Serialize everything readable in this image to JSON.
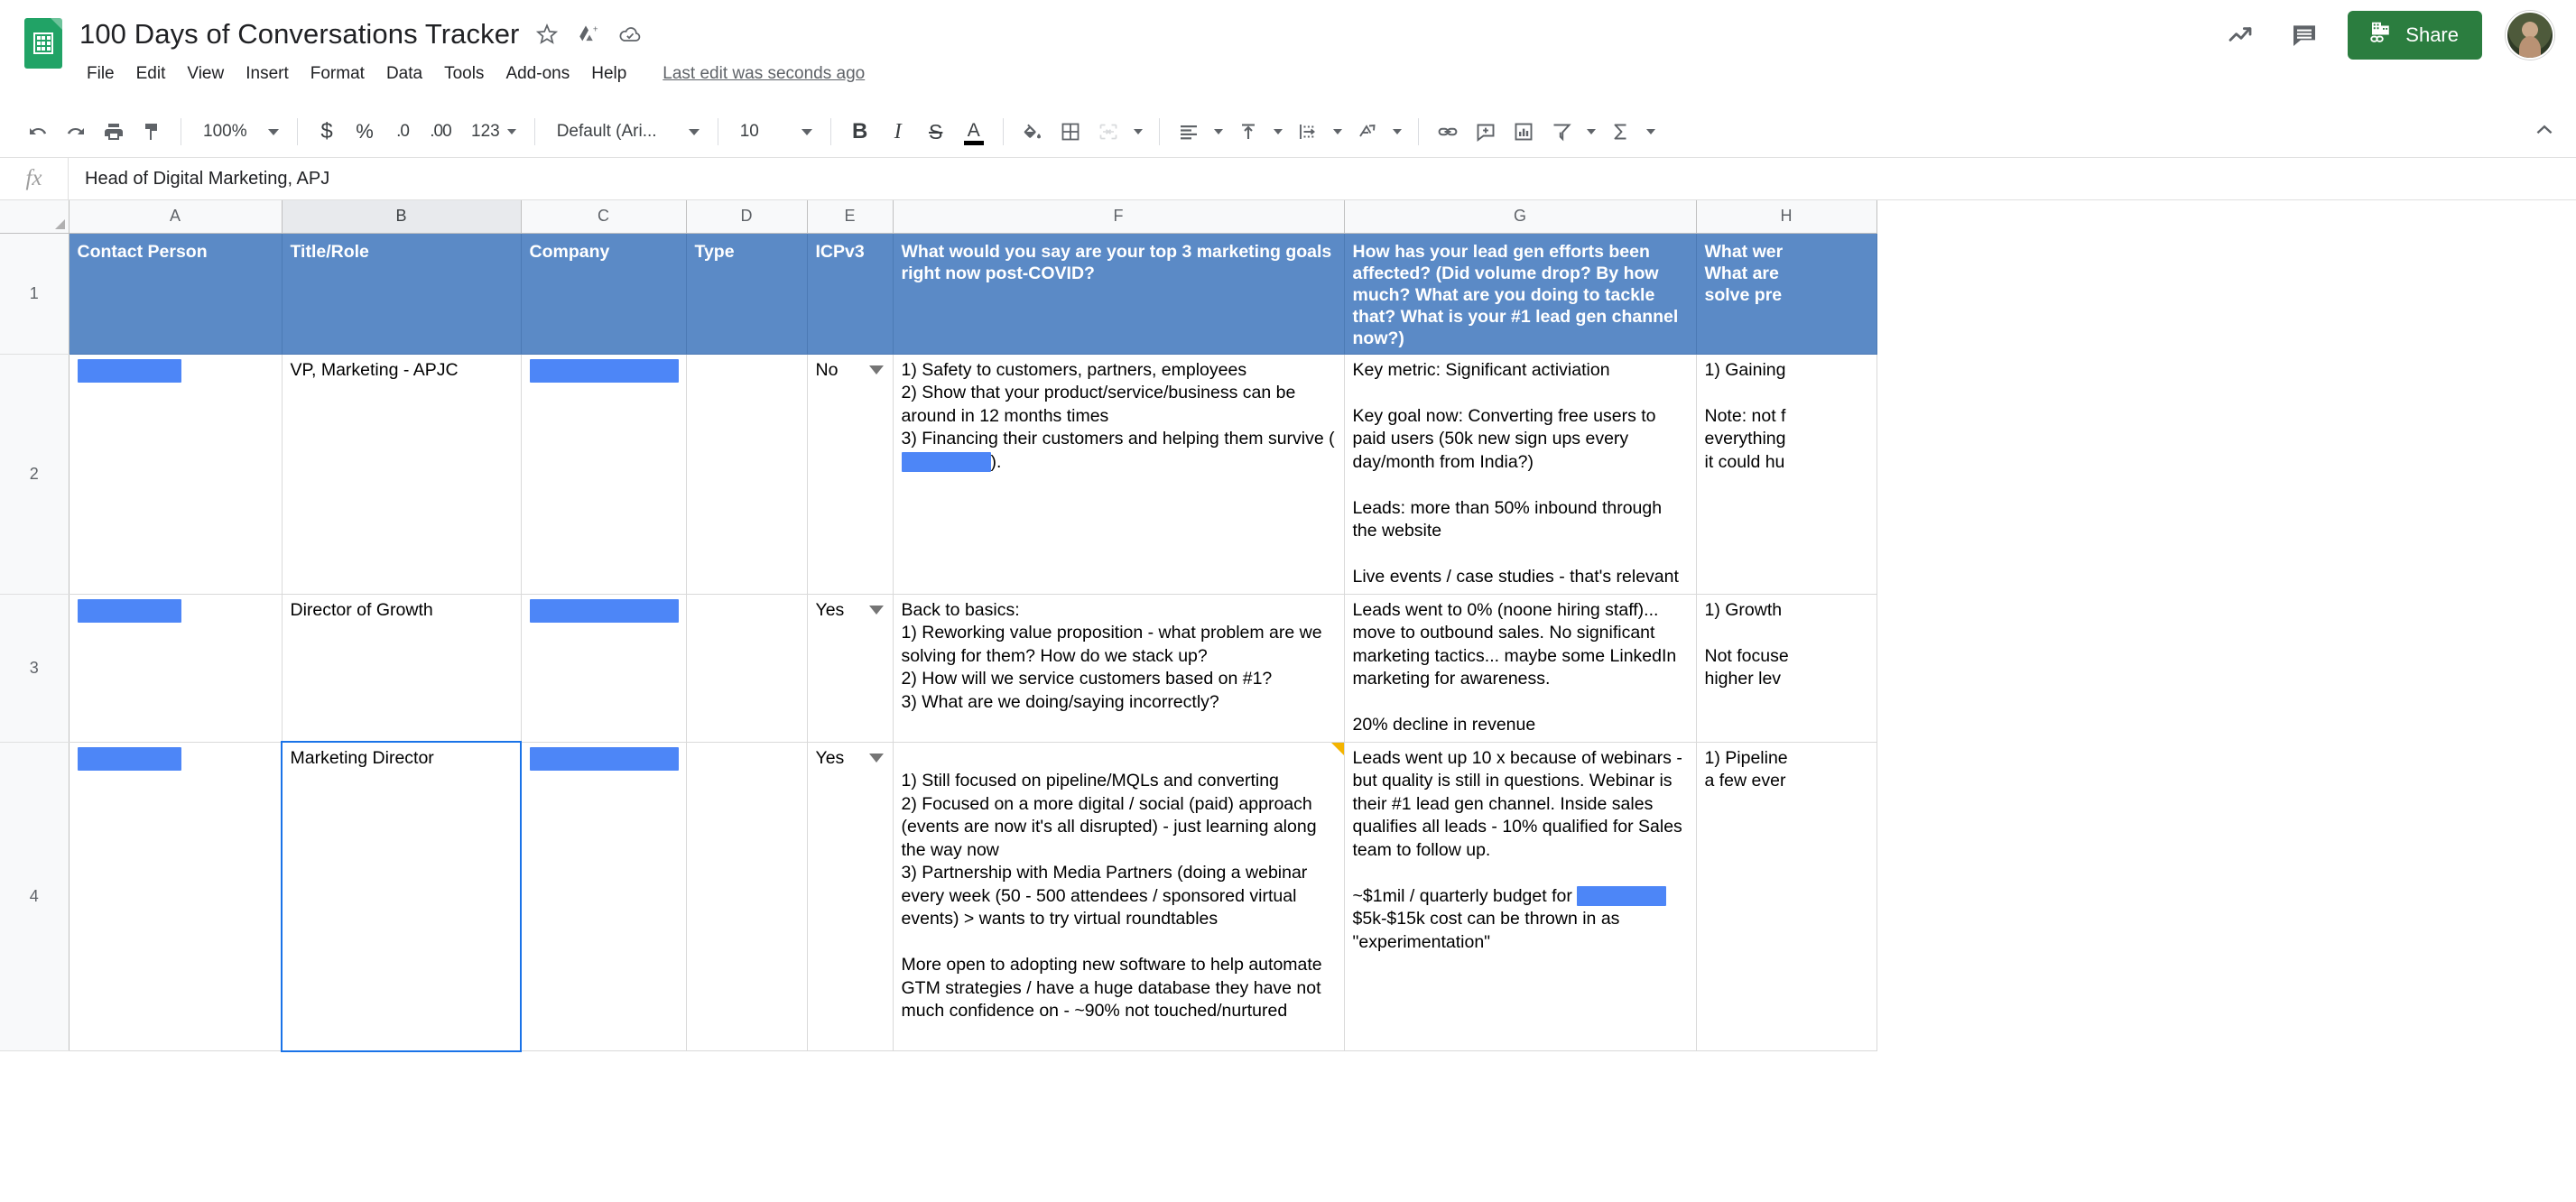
{
  "document": {
    "title": "100 Days of Conversations Tracker",
    "last_edit": "Last edit was seconds ago",
    "star_icon": "star-icon",
    "move_icon": "move-to-drive-icon",
    "cloud_icon": "cloud-saved-icon"
  },
  "menu": {
    "items": [
      "File",
      "Edit",
      "View",
      "Insert",
      "Format",
      "Data",
      "Tools",
      "Add-ons",
      "Help"
    ]
  },
  "header_right": {
    "trends_icon": "activity-trends-icon",
    "comments_icon": "comment-icon",
    "share_label": "Share",
    "avatar": "user-avatar"
  },
  "toolbar": {
    "undo": "undo-icon",
    "redo": "redo-icon",
    "print": "print-icon",
    "paint_format": "paint-format-icon",
    "zoom_value": "100%",
    "currency": "$",
    "percent": "%",
    "decrease_decimal": ".0",
    "increase_decimal": ".00",
    "more_formats": "123",
    "font_name": "Default (Ari...",
    "font_size": "10",
    "bold": "B",
    "italic": "I",
    "strikethrough": "S",
    "text_color": "A",
    "fill_color": "fill-color-icon",
    "borders": "borders-icon",
    "merge_cells": "merge-cells-icon",
    "horizontal_align": "horizontal-align-icon",
    "vertical_align": "vertical-align-icon",
    "text_wrap": "text-wrapping-icon",
    "text_rotation": "text-rotation-icon",
    "insert_link": "insert-link-icon",
    "insert_comment": "insert-comment-icon",
    "insert_chart": "insert-chart-icon",
    "create_filter": "filter-icon",
    "functions": "sum-functions-icon",
    "collapse": "collapse-toolbar-icon"
  },
  "formula_bar": {
    "fx": "fx",
    "value": "Head of Digital Marketing, APJ"
  },
  "grid": {
    "column_letters": [
      "A",
      "B",
      "C",
      "D",
      "E",
      "F",
      "G",
      "H"
    ],
    "selected_column": "B",
    "row_numbers": [
      "1",
      "2",
      "3",
      "4"
    ],
    "headers": {
      "A": "Contact Person",
      "B": "Title/Role",
      "C": "Company",
      "D": "Type",
      "E": "ICPv3",
      "F": "What would you say are your top 3 marketing goals right now post-COVID?",
      "G": "How has your lead gen efforts been affected? (Did volume drop? By how much? What are you doing to tackle that? What is your #1 lead gen channel now?)",
      "H": "What wer\nWhat are\nsolve pre"
    },
    "rows": [
      {
        "num": "2",
        "contact_person": "",
        "title_role": "VP, Marketing - APJC",
        "company": "",
        "type": "",
        "icp": "No",
        "goals": "1) Safety to customers, partners, employees\n2) Show that your product/service/business can be around in 12 months times\n3) Financing their customers and helping them survive (██████).",
        "leadgen": "Key metric: Significant activiation\n\nKey goal now: Converting free users to paid users (50k new sign ups every day/month from India?)\n\nLeads: more than 50% inbound through the website\n\nLive events / case studies - that's relevant",
        "col_h": "1) Gaining\n\nNote: not f\neverything\nit could hu"
      },
      {
        "num": "3",
        "contact_person": "",
        "title_role": "Director of Growth",
        "company": "",
        "type": "",
        "icp": "Yes",
        "goals": "Back to basics:\n1) Reworking value proposition - what problem are we solving for them? How do we stack up?\n2) How will we service customers based on #1?\n3) What are we doing/saying incorrectly?",
        "leadgen": "Leads went to 0% (noone hiring staff)... move to outbound sales. No significant marketing tactics... maybe some LinkedIn marketing for awareness.\n\n20% decline in revenue",
        "col_h": "1) Growth\n\nNot focuse\nhigher lev"
      },
      {
        "num": "4",
        "contact_person": "",
        "title_role": "Marketing Director",
        "company": "",
        "type": "",
        "icp": "Yes",
        "goals": "1) Still focused on pipeline/MQLs and converting\n2) Focused on a more digital / social (paid) approach (events are now it's all disrupted) - just learning along the way now\n3) Partnership with Media Partners (doing a webinar every week (50 - 500 attendees / sponsored virtual events) > wants to try virtual roundtables\n\nMore open to adopting new software to help automate GTM strategies / have a huge database they have not much confidence on - ~90% not touched/nurtured",
        "leadgen": "Leads went up 10 x because of webinars - but quality is still in questions. Webinar is their #1 lead gen channel. Inside sales qualifies all leads - 10% qualified for Sales team to follow up.\n\n~$1mil / quarterly budget for ██████\n$5k-$15k cost can be thrown in as \"experimentation\"",
        "col_h": "1) Pipeline\na few ever"
      }
    ]
  },
  "colors": {
    "header_blue": "#5b8ac6",
    "redaction_blue": "#4d86f7",
    "share_green": "#2b7d3f",
    "sheets_green": "#21a366",
    "selection_blue": "#1a73e8",
    "comment_flag": "#f4b400"
  }
}
